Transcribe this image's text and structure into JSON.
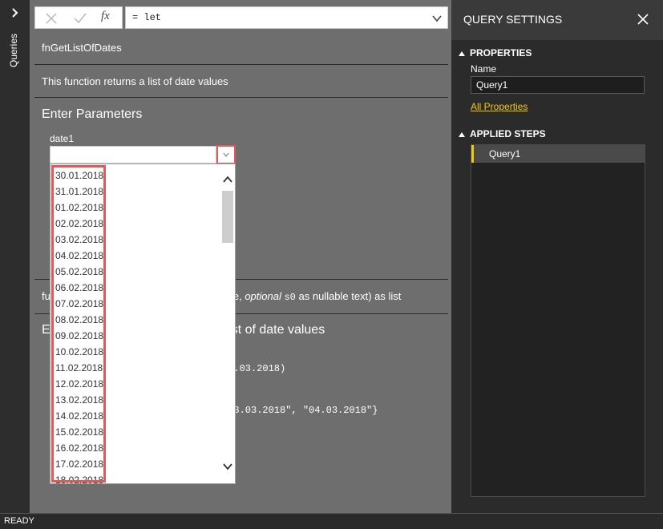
{
  "queries_pane": {
    "label": "Queries",
    "expand_icon": "chevron-right-icon"
  },
  "formula_bar": {
    "cancel_icon": "x-icon",
    "commit_icon": "check-icon",
    "fx_label": "fx",
    "formula": "= let"
  },
  "function": {
    "name": "fnGetListOfDates",
    "description": "This function returns a list of date values",
    "params_title": "Enter Parameters",
    "param_label": "date1",
    "param_value": "",
    "signature_prefix": "fu",
    "signature_mid": "e, ",
    "signature_optional": "optional",
    "signature_s0": "s0",
    "signature_suffix": " as nullable text) as list",
    "example_title_prefix": "E",
    "example_title_suffix": "st of date values",
    "example_code_1": "04.03.2018)",
    "example_code_2": "\"03.03.2018\", \"04.03.2018\"}"
  },
  "dropdown": {
    "options": [
      "30.01.2018",
      "31.01.2018",
      "01.02.2018",
      "02.02.2018",
      "03.02.2018",
      "04.02.2018",
      "05.02.2018",
      "06.02.2018",
      "07.02.2018",
      "08.02.2018",
      "09.02.2018",
      "10.02.2018",
      "11.02.2018",
      "12.02.2018",
      "13.02.2018",
      "14.02.2018",
      "15.02.2018",
      "16.02.2018",
      "17.02.2018",
      "18.02.2018"
    ]
  },
  "settings": {
    "title": "QUERY SETTINGS",
    "properties_title": "PROPERTIES",
    "name_label": "Name",
    "name_value": "Query1",
    "all_properties": "All Properties",
    "applied_steps_title": "APPLIED STEPS",
    "steps": [
      "Query1"
    ]
  },
  "status": {
    "text": "READY"
  },
  "colors": {
    "accent": "#f2c811",
    "highlight": "#e05a5a"
  }
}
